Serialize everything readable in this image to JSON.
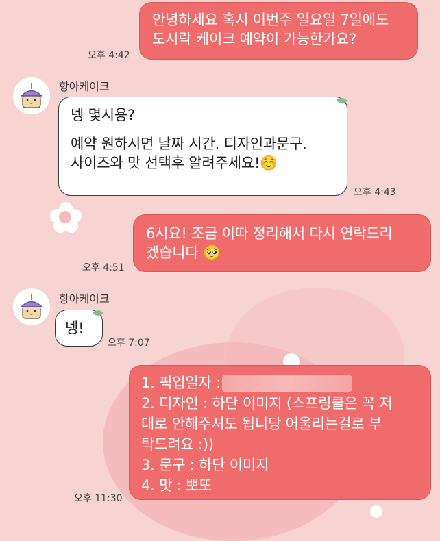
{
  "theme": {
    "background": "#f7d3d2",
    "outgoing": "#f06b6c",
    "incoming": "#ffffff"
  },
  "messages": [
    {
      "id": "m1",
      "side": "out",
      "lines": [
        "안녕하세요 혹시 이번주 일요일 7일에도",
        "도시락 케이크 예약이 가능한가요?"
      ],
      "time": "오후 4:42"
    },
    {
      "id": "m2",
      "side": "in",
      "sender": "항아케이크",
      "lines": [
        "넹 몇시용?",
        "",
        "예약 원하시면 날짜 시간. 디자인과문구.",
        "사이즈와 맛 선택후 알려주세요!☺️"
      ],
      "time": "오후 4:43"
    },
    {
      "id": "m3",
      "side": "out",
      "lines": [
        "6시요! 조금 이따 정리해서 다시 연락드리",
        "겠습니다 🥺"
      ],
      "time": "오후 4:51"
    },
    {
      "id": "m4",
      "side": "in",
      "sender": "항아케이크",
      "lines": [
        "넹!"
      ],
      "time": "오후 7:07"
    },
    {
      "id": "m5",
      "side": "out",
      "pickup_label": "1. 픽업일자 :",
      "lines": [
        "2. 디자인 : 하단 이미지 (스프링클은 꼭 저",
        "대로 안해주셔도 됩니당 어울리는걸로 부",
        "탁드려요 :))",
        "3. 문구 : 하단 이미지",
        "4. 맛 : 뽀또"
      ],
      "time": "오후 11:30"
    }
  ]
}
